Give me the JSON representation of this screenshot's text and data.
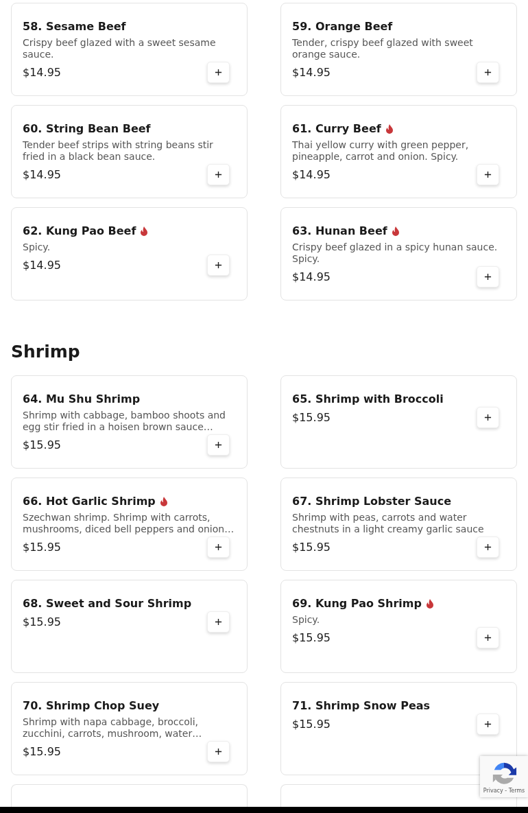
{
  "sections": [
    {
      "items": [
        {
          "kind": "dish",
          "name": "58. Sesame Beef",
          "spicy": false,
          "description": "Crispy beef glazed with a sweet sesame sauce.",
          "price": "$14.95"
        },
        {
          "kind": "dish",
          "name": "59. Orange Beef",
          "spicy": false,
          "description": "Tender, crispy beef glazed with sweet orange sauce.",
          "price": "$14.95"
        },
        {
          "kind": "dish",
          "name": "60. String Bean Beef",
          "spicy": false,
          "description": "Tender beef strips with string beans stir fried in a black bean sauce.",
          "price": "$14.95"
        },
        {
          "kind": "dish",
          "name": "61. Curry Beef",
          "spicy": true,
          "description": "Thai yellow curry with green pepper, pineapple, carrot and onion. Spicy.",
          "price": "$14.95"
        },
        {
          "kind": "dish",
          "name": "62. Kung Pao Beef",
          "spicy": true,
          "description": "Spicy.",
          "price": "$14.95"
        },
        {
          "kind": "dish",
          "name": "63. Hunan Beef",
          "spicy": true,
          "description": "Crispy beef glazed in a spicy hunan sauce. Spicy.",
          "price": "$14.95"
        }
      ]
    },
    {
      "title": "Shrimp",
      "items": [
        {
          "kind": "dish",
          "name": "64. Mu Shu Shrimp",
          "spicy": false,
          "description": "Shrimp with cabbage, bamboo shoots and egg stir fried in a hoisen brown sauce…",
          "price": "$15.95"
        },
        {
          "kind": "dish",
          "name": "65. Shrimp with Broccoli",
          "spicy": false,
          "price": "$15.95"
        },
        {
          "kind": "dish",
          "name": "66. Hot Garlic Shrimp",
          "spicy": true,
          "description": "Szechwan shrimp. Shrimp with carrots, mushrooms, diced bell peppers and onion…",
          "price": "$15.95"
        },
        {
          "kind": "dish",
          "name": "67. Shrimp Lobster Sauce",
          "spicy": false,
          "description": "Shrimp with peas, carrots and water chestnuts in a light creamy garlic sauce",
          "price": "$15.95"
        },
        {
          "kind": "dish",
          "name": "68. Sweet and Sour Shrimp",
          "spicy": false,
          "price": "$15.95"
        },
        {
          "kind": "dish",
          "name": "69. Kung Pao Shrimp",
          "spicy": true,
          "description": "Spicy.",
          "price": "$15.95"
        },
        {
          "kind": "dish",
          "name": "70. Shrimp Chop Suey",
          "spicy": false,
          "description": "Shrimp with napa cabbage, broccoli, zucchini, carrots, mushroom, water…",
          "price": "$15.95"
        },
        {
          "kind": "dish",
          "name": "71. Shrimp Snow Peas",
          "spicy": false,
          "price": "$15.95"
        },
        {
          "kind": "cut_off"
        },
        {
          "kind": "cut_off"
        }
      ]
    }
  ],
  "recaptcha": {
    "links": "Privacy - Terms"
  }
}
